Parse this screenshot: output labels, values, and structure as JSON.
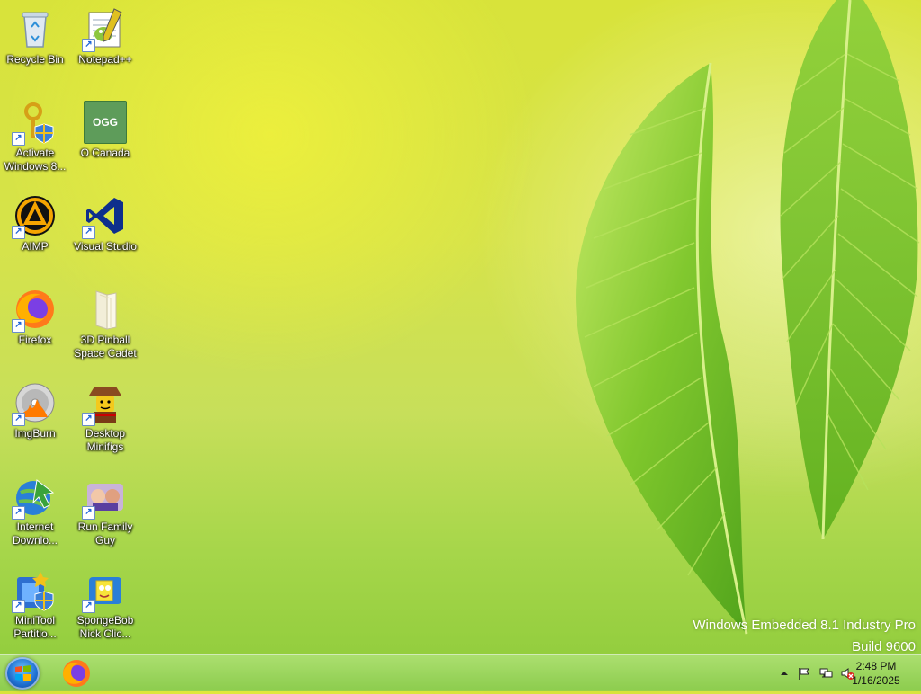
{
  "desktop": {
    "icons": [
      {
        "label": "Recycle Bin",
        "icon": "recycle-bin-icon",
        "shortcut": false
      },
      {
        "label": "Notepad++",
        "icon": "notepad-plus-plus-icon",
        "shortcut": true
      },
      {
        "label": "Activate Windows 8...",
        "icon": "key-shield-icon",
        "shortcut": true
      },
      {
        "label": "O Canada",
        "icon": "ogg-file-icon",
        "badge": "OGG",
        "shortcut": false
      },
      {
        "label": "AIMP",
        "icon": "aimp-icon",
        "shortcut": true
      },
      {
        "label": "Visual Studio",
        "icon": "visual-studio-icon",
        "shortcut": true
      },
      {
        "label": "Firefox",
        "icon": "firefox-icon",
        "shortcut": true
      },
      {
        "label": "3D Pinball Space Cadet",
        "icon": "folder-icon",
        "shortcut": false
      },
      {
        "label": "ImgBurn",
        "icon": "imgburn-disc-icon",
        "shortcut": true
      },
      {
        "label": "Desktop Minifigs",
        "icon": "lego-minifig-icon",
        "shortcut": true
      },
      {
        "label": "Internet Downlo...",
        "icon": "internet-download-manager-icon",
        "shortcut": true
      },
      {
        "label": "Run Family Guy",
        "icon": "family-guy-icon",
        "shortcut": true
      },
      {
        "label": "MiniTool Partitio...",
        "icon": "minitool-partition-icon",
        "shortcut": true
      },
      {
        "label": "SpongeBob Nick Clic...",
        "icon": "spongebob-icon",
        "shortcut": true
      }
    ]
  },
  "watermark": {
    "line1": "Windows Embedded 8.1 Industry Pro",
    "line2": "Build 9600"
  },
  "taskbar": {
    "start_icon": "windows-start-orb-icon",
    "pinned": [
      "firefox-icon"
    ],
    "tray_icons": [
      "chevron-up-icon",
      "action-center-flag-icon",
      "network-icon",
      "volume-muted-icon"
    ],
    "clock_time": "2:48 PM",
    "clock_date": "1/16/2025"
  },
  "colors": {
    "wallpaper_yellow": "#d8e33a",
    "wallpaper_green": "#8dcb3a",
    "leaf": "#7cc62a",
    "taskbar": "#9fd860"
  }
}
